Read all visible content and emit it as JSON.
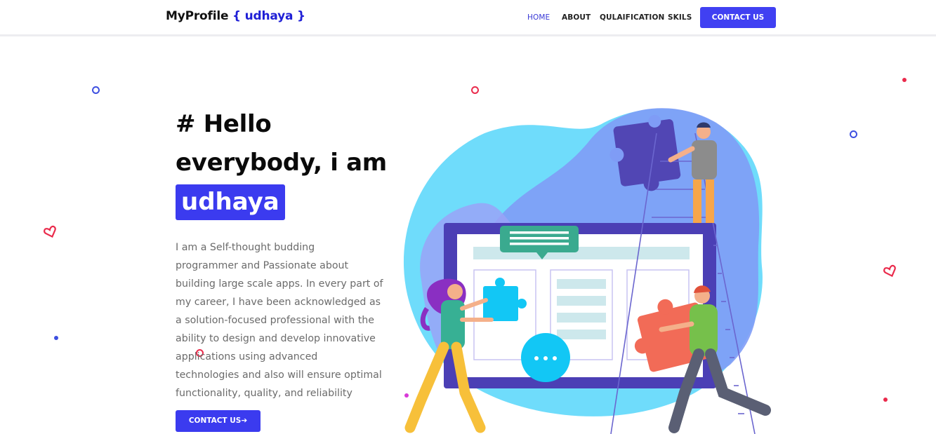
{
  "nav": {
    "brand": "MyProfile",
    "brand_accent": "{ udhaya }",
    "items": [
      {
        "label": "HOME",
        "active": true
      },
      {
        "label": "ABOUT",
        "active": false
      },
      {
        "label": "QULAIFICATION",
        "active": false
      },
      {
        "label": "SKILS",
        "active": false
      }
    ],
    "cta": "CONTACT US"
  },
  "hero": {
    "line1": "# Hello",
    "line2": "everybody, i am",
    "name": "udhaya",
    "bio_lines": [
      "I am a Self-thought budding",
      "programmer and Passionate about",
      "building large scale apps. In every part of",
      "my career, I have been acknowledged as",
      "a solution-focused professional with the",
      "ability to design and develop innovative",
      "applications using advanced",
      "technologies and also will ensure optimal",
      "functionality, quality, and reliability"
    ],
    "cta": "CONTACT US",
    "cta_arrow": "➔"
  },
  "colors": {
    "accent": "#3b3bef",
    "brand_accent": "#1f1fd6",
    "deco_red": "#ea2a4b",
    "deco_blue": "#3d4fe0"
  },
  "icons": {
    "cta_arrow": "arrow-right-icon",
    "illustration": "teamwork-puzzle-illustration"
  }
}
